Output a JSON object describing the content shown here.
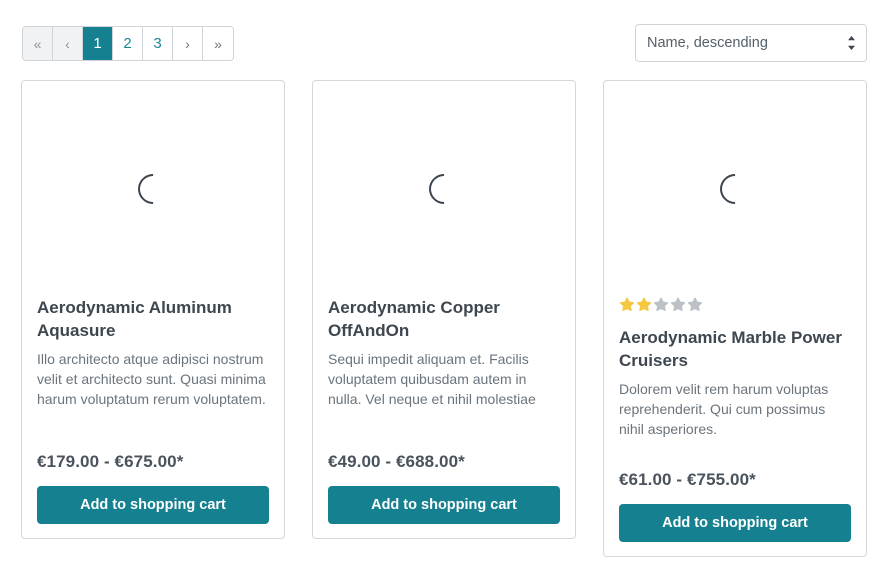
{
  "pagination": {
    "first_label": "«",
    "prev_label": "‹",
    "next_label": "›",
    "last_label": "»",
    "pages": [
      "1",
      "2",
      "3"
    ],
    "active_page": "1"
  },
  "sorting": {
    "selected": "Name, descending",
    "options": [
      "Name, descending"
    ]
  },
  "colors": {
    "accent": "#15808f",
    "star_filled": "#f5c842",
    "star_empty": "#bcc1c7",
    "border": "#d3d8dd",
    "title": "#3e4750",
    "description": "#6a747d"
  },
  "products": [
    {
      "title": "Aerodynamic Aluminum Aquasure",
      "description": "Illo architecto atque adipisci nostrum velit et architecto sunt. Quasi minima harum voluptatum rerum voluptatem.",
      "price": "€179.00 - €675.00*",
      "buy_label": "Add to shopping cart",
      "rating": null,
      "rating_max": 5
    },
    {
      "title": "Aerodynamic Copper OffAndOn",
      "description": "Sequi impedit aliquam et. Facilis voluptatem quibusdam autem in nulla. Vel neque et nihil molestiae",
      "price": "€49.00 - €688.00*",
      "buy_label": "Add to shopping cart",
      "rating": null,
      "rating_max": 5
    },
    {
      "title": "Aerodynamic Marble Power Cruisers",
      "description": "Dolorem velit rem harum voluptas reprehenderit. Qui cum possimus nihil asperiores.",
      "price": "€61.00 - €755.00*",
      "buy_label": "Add to shopping cart",
      "rating": 2,
      "rating_max": 5
    }
  ]
}
